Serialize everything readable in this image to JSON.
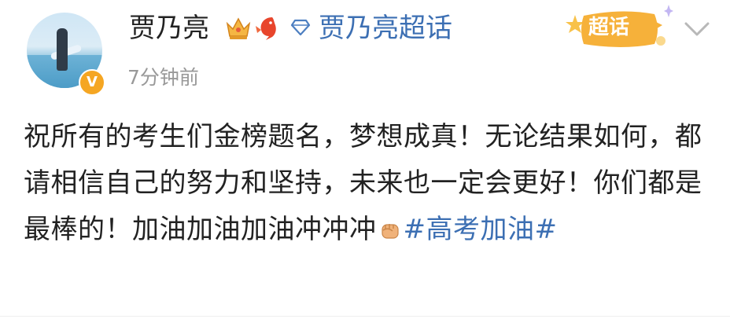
{
  "post": {
    "username": "贾乃亮",
    "topic_link": "贾乃亮超话",
    "timestamp": "7分钟前",
    "supertopic_badge": "超话",
    "verified_badge": "V",
    "body_text": "祝所有的考生们金榜题名，梦想成真！无论结果如何，都请相信自己的努力和坚持，未来也一定会更好！你们都是最棒的！加油加油加油冲冲冲",
    "hashtag": "#高考加油#"
  },
  "icons": {
    "crown": "crown-icon",
    "fish": "koi-fish-icon",
    "diamond": "diamond-icon",
    "fist": "fist-emoji-icon",
    "chevron": "chevron-down-icon",
    "verified": "verified-v-icon"
  },
  "colors": {
    "link_blue": "#3c6fb3",
    "text": "#222222",
    "timestamp_gray": "#999999",
    "badge_orange": "#f5a623"
  }
}
